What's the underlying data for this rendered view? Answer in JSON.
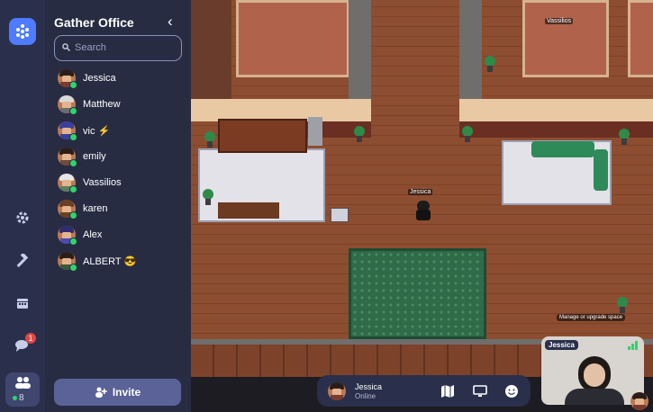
{
  "sidebar": {
    "people_count": "8",
    "notification_count": "1"
  },
  "panel": {
    "title": "Gather Office",
    "search_placeholder": "Search",
    "members": [
      {
        "name": "Jessica"
      },
      {
        "name": "Matthew"
      },
      {
        "name": "vic ⚡"
      },
      {
        "name": "emily"
      },
      {
        "name": "Vassilios"
      },
      {
        "name": "karen"
      },
      {
        "name": "Alex"
      },
      {
        "name": "ALBERT 😎"
      }
    ],
    "invite_label": "Invite"
  },
  "map": {
    "player_label": "Jessica",
    "other_label": "Vassilios",
    "hint": "Manage or upgrade space"
  },
  "bottom_bar": {
    "name": "Jessica",
    "status": "Online"
  },
  "video": {
    "name": "Jessica"
  },
  "colors": {
    "accent": "#4e7bff",
    "online": "#2fd46c",
    "panel_bg": "#282c43",
    "rail_bg": "#2a2f4b"
  }
}
